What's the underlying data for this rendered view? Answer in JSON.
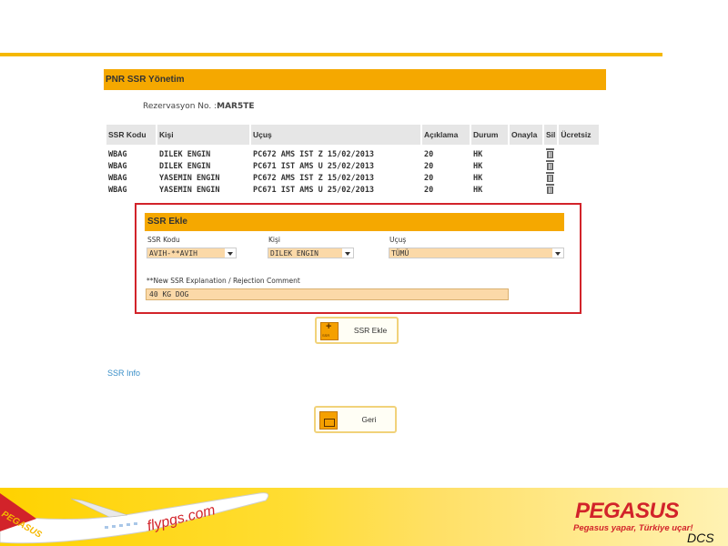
{
  "panel": {
    "title": "PNR SSR Yönetim"
  },
  "reservation": {
    "label": "Rezervasyon No. :",
    "value": "MAR5TE"
  },
  "table": {
    "headers": [
      "SSR Kodu",
      "Kişi",
      "Uçuş",
      "Açıklama",
      "Durum",
      "Onayla",
      "Sil",
      "Ücretsiz"
    ],
    "rows": [
      {
        "code": "WBAG",
        "person": "DILEK ENGIN",
        "flight": "PC672 AMS IST Z 15/02/2013",
        "desc": "20",
        "status": "HK"
      },
      {
        "code": "WBAG",
        "person": "DILEK ENGIN",
        "flight": "PC671 IST AMS U 25/02/2013",
        "desc": "20",
        "status": "HK"
      },
      {
        "code": "WBAG",
        "person": "YASEMIN ENGIN",
        "flight": "PC672 AMS IST Z 15/02/2013",
        "desc": "20",
        "status": "HK"
      },
      {
        "code": "WBAG",
        "person": "YASEMIN ENGIN",
        "flight": "PC671 IST AMS U 25/02/2013",
        "desc": "20",
        "status": "HK"
      }
    ],
    "delete_icon": "trash-icon"
  },
  "ssr_ekle": {
    "title": "SSR Ekle",
    "code_label": "SSR Kodu",
    "code_value": "AVIH-**AVIH",
    "person_label": "Kişi",
    "person_value": "DILEK ENGIN",
    "flight_label": "Uçuş",
    "flight_value": "TÜMÜ",
    "explanation_label": "**New SSR Explanation / Rejection Comment",
    "explanation_value": "40 KG DOG",
    "highlight_color": "#d2232a"
  },
  "buttons": {
    "add_label": "SSR Ekle",
    "back_label": "Geri"
  },
  "links": {
    "ssr_info": "SSR Info"
  },
  "footer": {
    "brand": "PEGASUS",
    "slogan": "Pegasus yapar, Türkiye uçar!",
    "plane_text": "flypgs.com",
    "plane_tail_text": "PEGASUS",
    "tag": "DCS"
  },
  "colors": {
    "accent": "#f5a800",
    "brand_red": "#d2232a",
    "link": "#3a8fc8"
  }
}
